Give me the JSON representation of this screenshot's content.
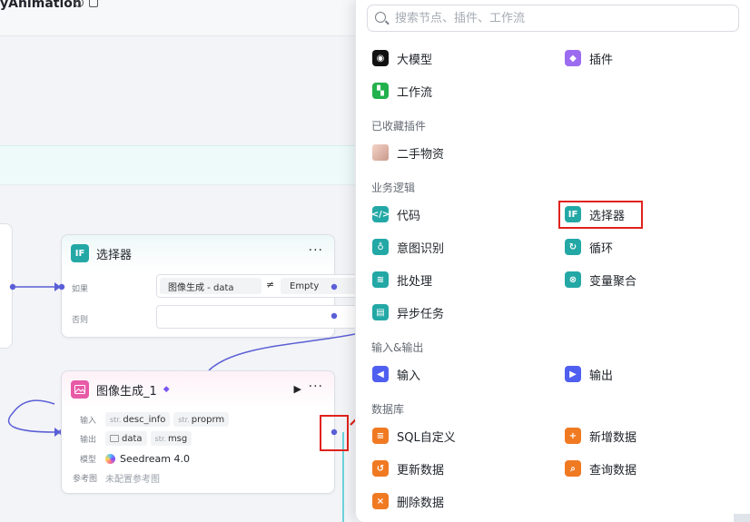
{
  "workflow": {
    "title": "yAnimation"
  },
  "selector_node": {
    "icon_text": "IF",
    "title": "选择器",
    "more": "···",
    "if_label": "如果",
    "cond_left": "图像生成  -  data",
    "cond_op": "≠",
    "cond_right": "Empty",
    "else_label": "否则"
  },
  "image_node": {
    "title": "图像生成_1",
    "more": "···",
    "run": "▶",
    "input_label": "输入",
    "inputs": [
      {
        "type": "str.",
        "name": "desc_info"
      },
      {
        "type": "str.",
        "name": "proprm"
      }
    ],
    "output_label": "输出",
    "outputs": [
      {
        "type": "",
        "name": "data"
      },
      {
        "type": "str.",
        "name": "msg"
      }
    ],
    "model_label": "模型",
    "model_name": "Seedream 4.0",
    "ref_label": "参考图",
    "ref_value": "未配置参考图"
  },
  "panel": {
    "search_placeholder": "搜索节点、插件、工作流",
    "top": [
      {
        "label": "大模型",
        "icon": "llm-icon",
        "color": "#111111"
      },
      {
        "label": "插件",
        "icon": "plugin-icon",
        "color": "#9b6cf0"
      },
      {
        "label": "工作流",
        "icon": "workflow-icon",
        "color": "#22b14c"
      }
    ],
    "favorites_title": "已收藏插件",
    "favorites": [
      {
        "label": "二手物资",
        "icon": "avatar-icon"
      }
    ],
    "logic_title": "业务逻辑",
    "logic": [
      {
        "label": "代码",
        "icon": "code-icon",
        "color": "#23a8a6"
      },
      {
        "label": "选择器",
        "icon": "if-icon",
        "color": "#23a8a6"
      },
      {
        "label": "意图识别",
        "icon": "intent-icon",
        "color": "#23a8a6"
      },
      {
        "label": "循环",
        "icon": "loop-icon",
        "color": "#23a8a6"
      },
      {
        "label": "批处理",
        "icon": "batch-icon",
        "color": "#23a8a6"
      },
      {
        "label": "变量聚合",
        "icon": "aggregate-icon",
        "color": "#23a8a6"
      },
      {
        "label": "异步任务",
        "icon": "async-icon",
        "color": "#23a8a6"
      }
    ],
    "io_title": "输入&输出",
    "io": [
      {
        "label": "输入",
        "icon": "input-icon",
        "color": "#4f5ff0"
      },
      {
        "label": "输出",
        "icon": "output-icon",
        "color": "#4f5ff0"
      }
    ],
    "db_title": "数据库",
    "db": [
      {
        "label": "SQL自定义",
        "icon": "sql-icon",
        "color": "#f07a22"
      },
      {
        "label": "新增数据",
        "icon": "add-data-icon",
        "color": "#f07a22"
      },
      {
        "label": "更新数据",
        "icon": "update-data-icon",
        "color": "#f07a22"
      },
      {
        "label": "查询数据",
        "icon": "query-data-icon",
        "color": "#f07a22"
      },
      {
        "label": "删除数据",
        "icon": "delete-data-icon",
        "color": "#f07a22"
      }
    ]
  },
  "colors": {
    "annotation_red": "#e0221c",
    "wire_blue": "#5b5fd6",
    "wire_cyan": "#3fc6d4"
  }
}
